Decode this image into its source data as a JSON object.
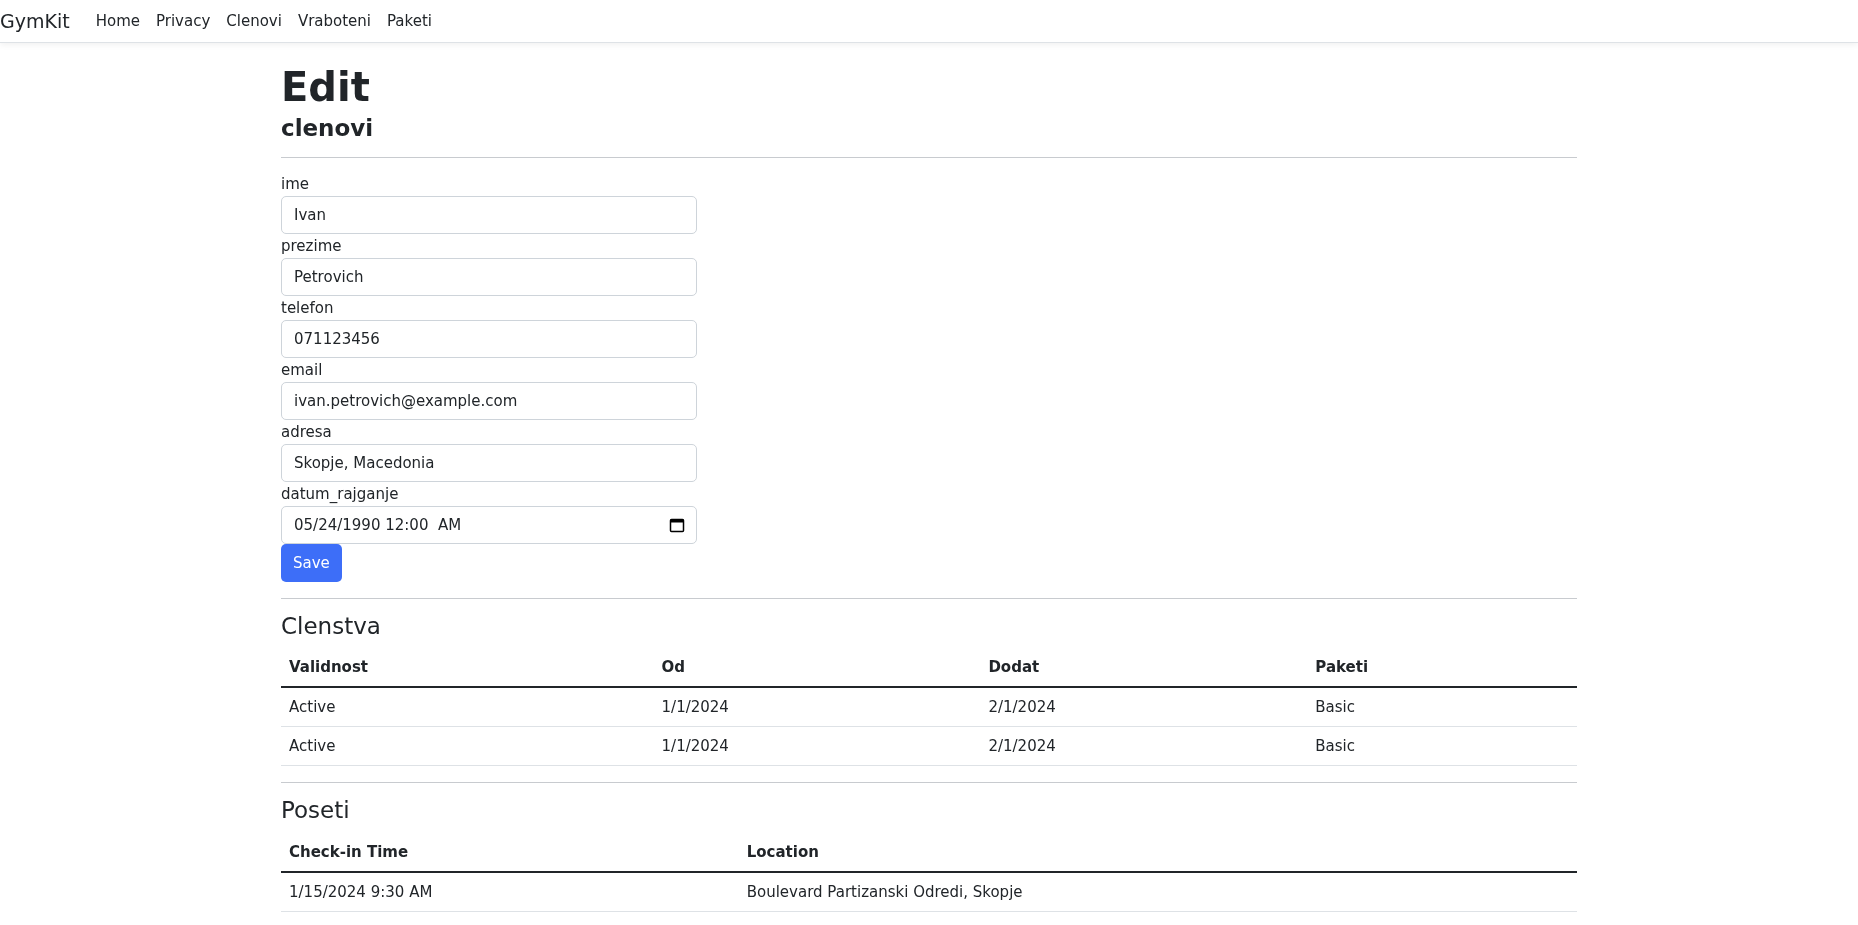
{
  "navbar": {
    "brand": "GymKit",
    "links": [
      "Home",
      "Privacy",
      "Clenovi",
      "Vraboteni",
      "Paketi"
    ]
  },
  "page": {
    "title": "Edit",
    "subtitle": "clenovi"
  },
  "form": {
    "fields": [
      {
        "label": "ime",
        "value": "Ivan",
        "kind": "text"
      },
      {
        "label": "prezime",
        "value": "Petrovich",
        "kind": "text"
      },
      {
        "label": "telefon",
        "value": "071123456",
        "kind": "text"
      },
      {
        "label": "email",
        "value": "ivan.petrovich@example.com",
        "kind": "text"
      },
      {
        "label": "adresa",
        "value": "Skopje, Macedonia",
        "kind": "text"
      },
      {
        "label": "datum_rajganje",
        "value": "05/24/1990 12:00  AM",
        "kind": "datetime"
      }
    ],
    "submit": "Save"
  },
  "sections": [
    {
      "title": "Clenstva",
      "columns": [
        "Validnost",
        "Od",
        "Dodat",
        "Paketi"
      ],
      "rows": [
        [
          "Active",
          "1/1/2024",
          "2/1/2024",
          "Basic"
        ],
        [
          "Active",
          "1/1/2024",
          "2/1/2024",
          "Basic"
        ]
      ]
    },
    {
      "title": "Poseti",
      "columns": [
        "Check-in Time",
        "Location"
      ],
      "rows": [
        [
          "1/15/2024 9:30 AM",
          "Boulevard Partizanski Odredi, Skopje"
        ]
      ]
    }
  ]
}
